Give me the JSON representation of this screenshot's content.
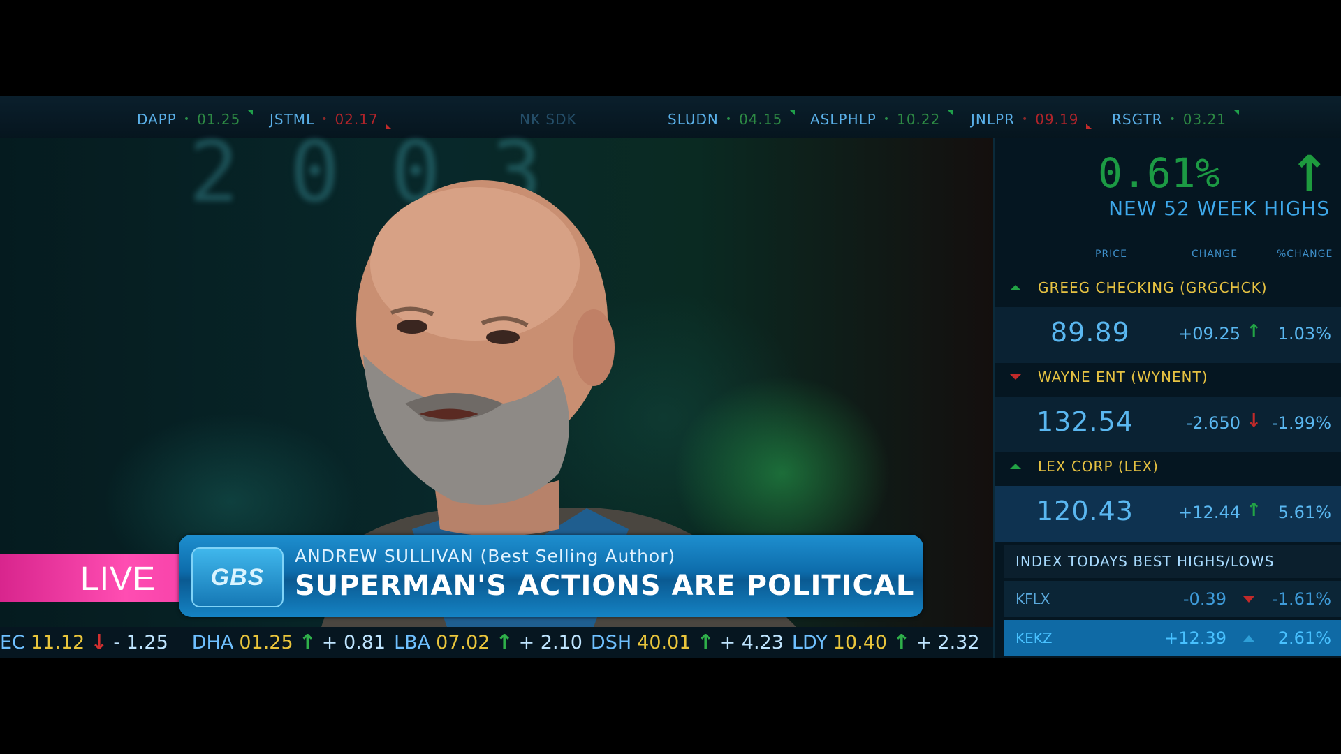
{
  "top_ticker": [
    {
      "symbol": "DAPP",
      "value": "01.25",
      "dir": "up"
    },
    {
      "symbol": "JSTML",
      "value": "02.17",
      "dir": "down"
    },
    {
      "symbol": "NK SDK",
      "value": "",
      "dir": "faded"
    },
    {
      "symbol": "SLUDN",
      "value": "04.15",
      "dir": "up"
    },
    {
      "symbol": "ASLPHLP",
      "value": "10.22",
      "dir": "up"
    },
    {
      "symbol": "JNLPR",
      "value": "09.19",
      "dir": "down"
    },
    {
      "symbol": "RSGTR",
      "value": "03.21",
      "dir": "up"
    }
  ],
  "lower_third": {
    "live_label": "LIVE",
    "logo": "GBS",
    "name_line": "ANDREW SULLIVAN (Best Selling Author)",
    "headline": "SUPERMAN'S ACTIONS ARE POLITICAL"
  },
  "bottom_ticker": [
    {
      "symbol": "JEC",
      "value": "11.12",
      "dir": "down",
      "change": "- 1.25"
    },
    {
      "symbol": "DHA",
      "value": "01.25",
      "dir": "up",
      "change": "+ 0.81"
    },
    {
      "symbol": "LBA",
      "value": "07.02",
      "dir": "up",
      "change": "+ 2.10"
    },
    {
      "symbol": "DSH",
      "value": "40.01",
      "dir": "up",
      "change": "+ 4.23"
    },
    {
      "symbol": "LDY",
      "value": "10.40",
      "dir": "up",
      "change": "+ 2.32"
    }
  ],
  "panel": {
    "big_percent": "0.61%",
    "subtitle": "NEW 52 WEEK HIGHS",
    "columns": [
      "PRICE",
      "CHANGE",
      "%CHANGE"
    ],
    "stocks": [
      {
        "name": "GREEG CHECKING  (GRGCHCK)",
        "dir": "up",
        "price": "89.89",
        "change": "+09.25",
        "pchange": "1.03%"
      },
      {
        "name": "WAYNE ENT   (WYNENT)",
        "dir": "down",
        "price": "132.54",
        "change": "-2.650",
        "pchange": "-1.99%"
      },
      {
        "name": "LEX CORP  (LEX)",
        "dir": "up",
        "price": "120.43",
        "change": "+12.44",
        "pchange": "5.61%"
      }
    ],
    "index_title": "INDEX TODAYS BEST HIGHS/LOWS",
    "index_rows": [
      {
        "symbol": "KFLX",
        "change": "-0.39",
        "dir": "down",
        "pchange": "-1.61%"
      },
      {
        "symbol": "KEKZ",
        "change": "+12.39",
        "dir": "up",
        "pchange": "2.61%"
      }
    ]
  },
  "colors": {
    "live_pink": "#ff4db2",
    "caption_blue": "#0d6cab",
    "up_green": "#22a345",
    "down_red": "#c22a2a",
    "ticker_blue": "#5ab0e8",
    "stock_gold": "#e6c242"
  },
  "icons": [
    "up-arrow-icon",
    "down-arrow-icon",
    "up-triangle-icon",
    "down-triangle-icon",
    "network-logo"
  ]
}
